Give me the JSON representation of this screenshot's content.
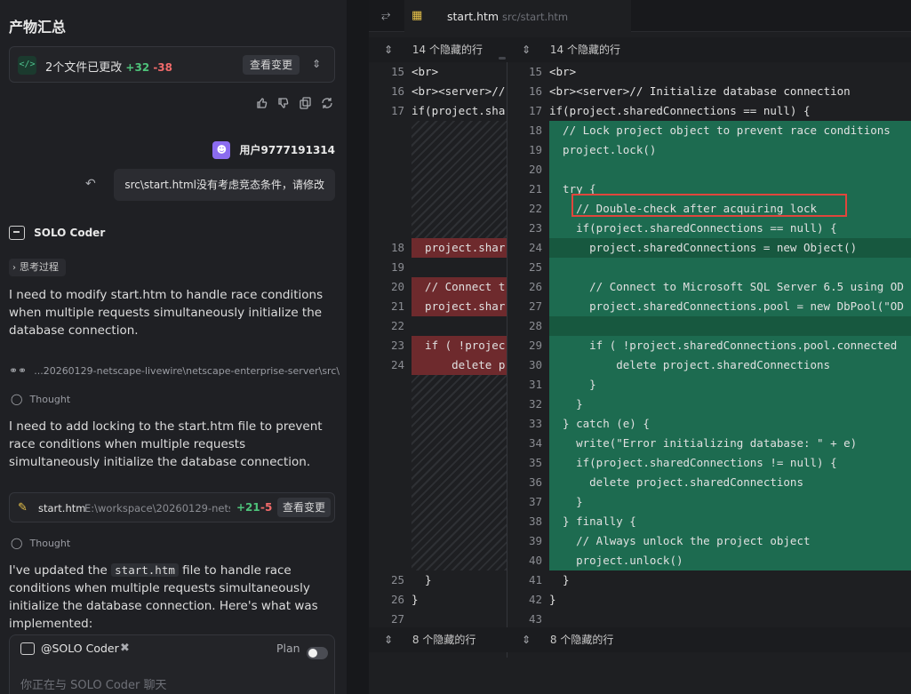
{
  "panel": {
    "title": "产物汇总",
    "changes": {
      "summary": "2个文件已更改",
      "added": "+32",
      "removed": "-38",
      "view_label": "查看变更"
    },
    "user": {
      "name": "用户9777191314",
      "message": "src\\start.html没有考虑竞态条件，请修改"
    },
    "agent": {
      "name": "SOLO Coder",
      "thinking_label": "思考过程",
      "msg1": "I need to modify start.htm to handle race conditions when multiple requests simultaneously initialize the database connection.",
      "path_ref": "...20260129-netscape-livewire\\netscape-enterprise-server\\src\\start.htm",
      "thought_label": "Thought",
      "msg2": "I need to add locking to the start.htm file to prevent race conditions when multiple requests simultaneously initialize the database connection.",
      "file_card": {
        "name": "start.htm",
        "path": "E:\\workspace\\20260129-nets...",
        "added": "+21",
        "removed": "-5",
        "view_label": "查看变更"
      },
      "thought_label2": "Thought",
      "msg3_a": "I've updated the ",
      "msg3_code": "start.htm",
      "msg3_b": " file to handle race conditions when multiple requests simultaneously initialize the database connection. Here's what was implemented:"
    },
    "input": {
      "mention": "@SOLO Coder",
      "mode_label": "Plan",
      "placeholder": "你正在与 SOLO Coder 聊天"
    }
  },
  "editor": {
    "tab": {
      "name": "start.htm",
      "path": "src/start.htm"
    },
    "hidden_top": "14 个隐藏的行",
    "hidden_bottom": "8 个隐藏的行",
    "left_lines": [
      {
        "n": "15",
        "t": "<br>"
      },
      {
        "n": "16",
        "t": "<br><server>//"
      },
      {
        "n": "17",
        "t": "if(project.sha"
      },
      {
        "n": "18",
        "t": "  project.shar"
      },
      {
        "n": "19",
        "t": ""
      },
      {
        "n": "20",
        "t": "  // Connect t"
      },
      {
        "n": "21",
        "t": "  project.shar"
      },
      {
        "n": "22",
        "t": ""
      },
      {
        "n": "23",
        "t": "  if ( !projec"
      },
      {
        "n": "24",
        "t": "      delete p"
      },
      {
        "n": "25",
        "t": "  }"
      },
      {
        "n": "26",
        "t": "}"
      },
      {
        "n": "27",
        "t": ""
      }
    ],
    "right_lines": [
      {
        "n": "15",
        "t": "<br>"
      },
      {
        "n": "16",
        "t": "<br><server>// Initialize database connection"
      },
      {
        "n": "17",
        "t": "if(project.sharedConnections == null) {"
      },
      {
        "n": "18",
        "t": "  // Lock project object to prevent race conditions"
      },
      {
        "n": "19",
        "t": "  project.lock()"
      },
      {
        "n": "20",
        "t": ""
      },
      {
        "n": "21",
        "t": "  try {"
      },
      {
        "n": "22",
        "t": "    // Double-check after acquiring lock"
      },
      {
        "n": "23",
        "t": "    if(project.sharedConnections == null) {"
      },
      {
        "n": "24",
        "t": "      project.sharedConnections = new Object()"
      },
      {
        "n": "25",
        "t": ""
      },
      {
        "n": "26",
        "t": "      // Connect to Microsoft SQL Server 6.5 using OD"
      },
      {
        "n": "27",
        "t": "      project.sharedConnections.pool = new DbPool(\"OD"
      },
      {
        "n": "28",
        "t": ""
      },
      {
        "n": "29",
        "t": "      if ( !project.sharedConnections.pool.connected"
      },
      {
        "n": "30",
        "t": "          delete project.sharedConnections"
      },
      {
        "n": "31",
        "t": "      }"
      },
      {
        "n": "32",
        "t": "    }"
      },
      {
        "n": "33",
        "t": "  } catch (e) {"
      },
      {
        "n": "34",
        "t": "    write(\"Error initializing database: \" + e)"
      },
      {
        "n": "35",
        "t": "    if(project.sharedConnections != null) {"
      },
      {
        "n": "36",
        "t": "      delete project.sharedConnections"
      },
      {
        "n": "37",
        "t": "    }"
      },
      {
        "n": "38",
        "t": "  } finally {"
      },
      {
        "n": "39",
        "t": "    // Always unlock the project object"
      },
      {
        "n": "40",
        "t": "    project.unlock()"
      },
      {
        "n": "41",
        "t": "  }"
      },
      {
        "n": "42",
        "t": "}"
      },
      {
        "n": "43",
        "t": ""
      }
    ]
  },
  "colors": {
    "added": "#1d6b50",
    "removed": "#6e2a2d",
    "highlight": "#e0463c",
    "accent": "#8b6cf0"
  },
  "icons": [
    "code-icon",
    "chevron-updown-icon",
    "thumbs-up-icon",
    "thumbs-down-icon",
    "copy-icon",
    "refresh-icon",
    "user-icon",
    "undo-icon",
    "bot-icon",
    "chevron-right-icon",
    "glasses-icon",
    "lightbulb-icon",
    "edit-file-icon",
    "tools-icon",
    "collapse-icon",
    "diff-file-icon",
    "expand-icon"
  ]
}
